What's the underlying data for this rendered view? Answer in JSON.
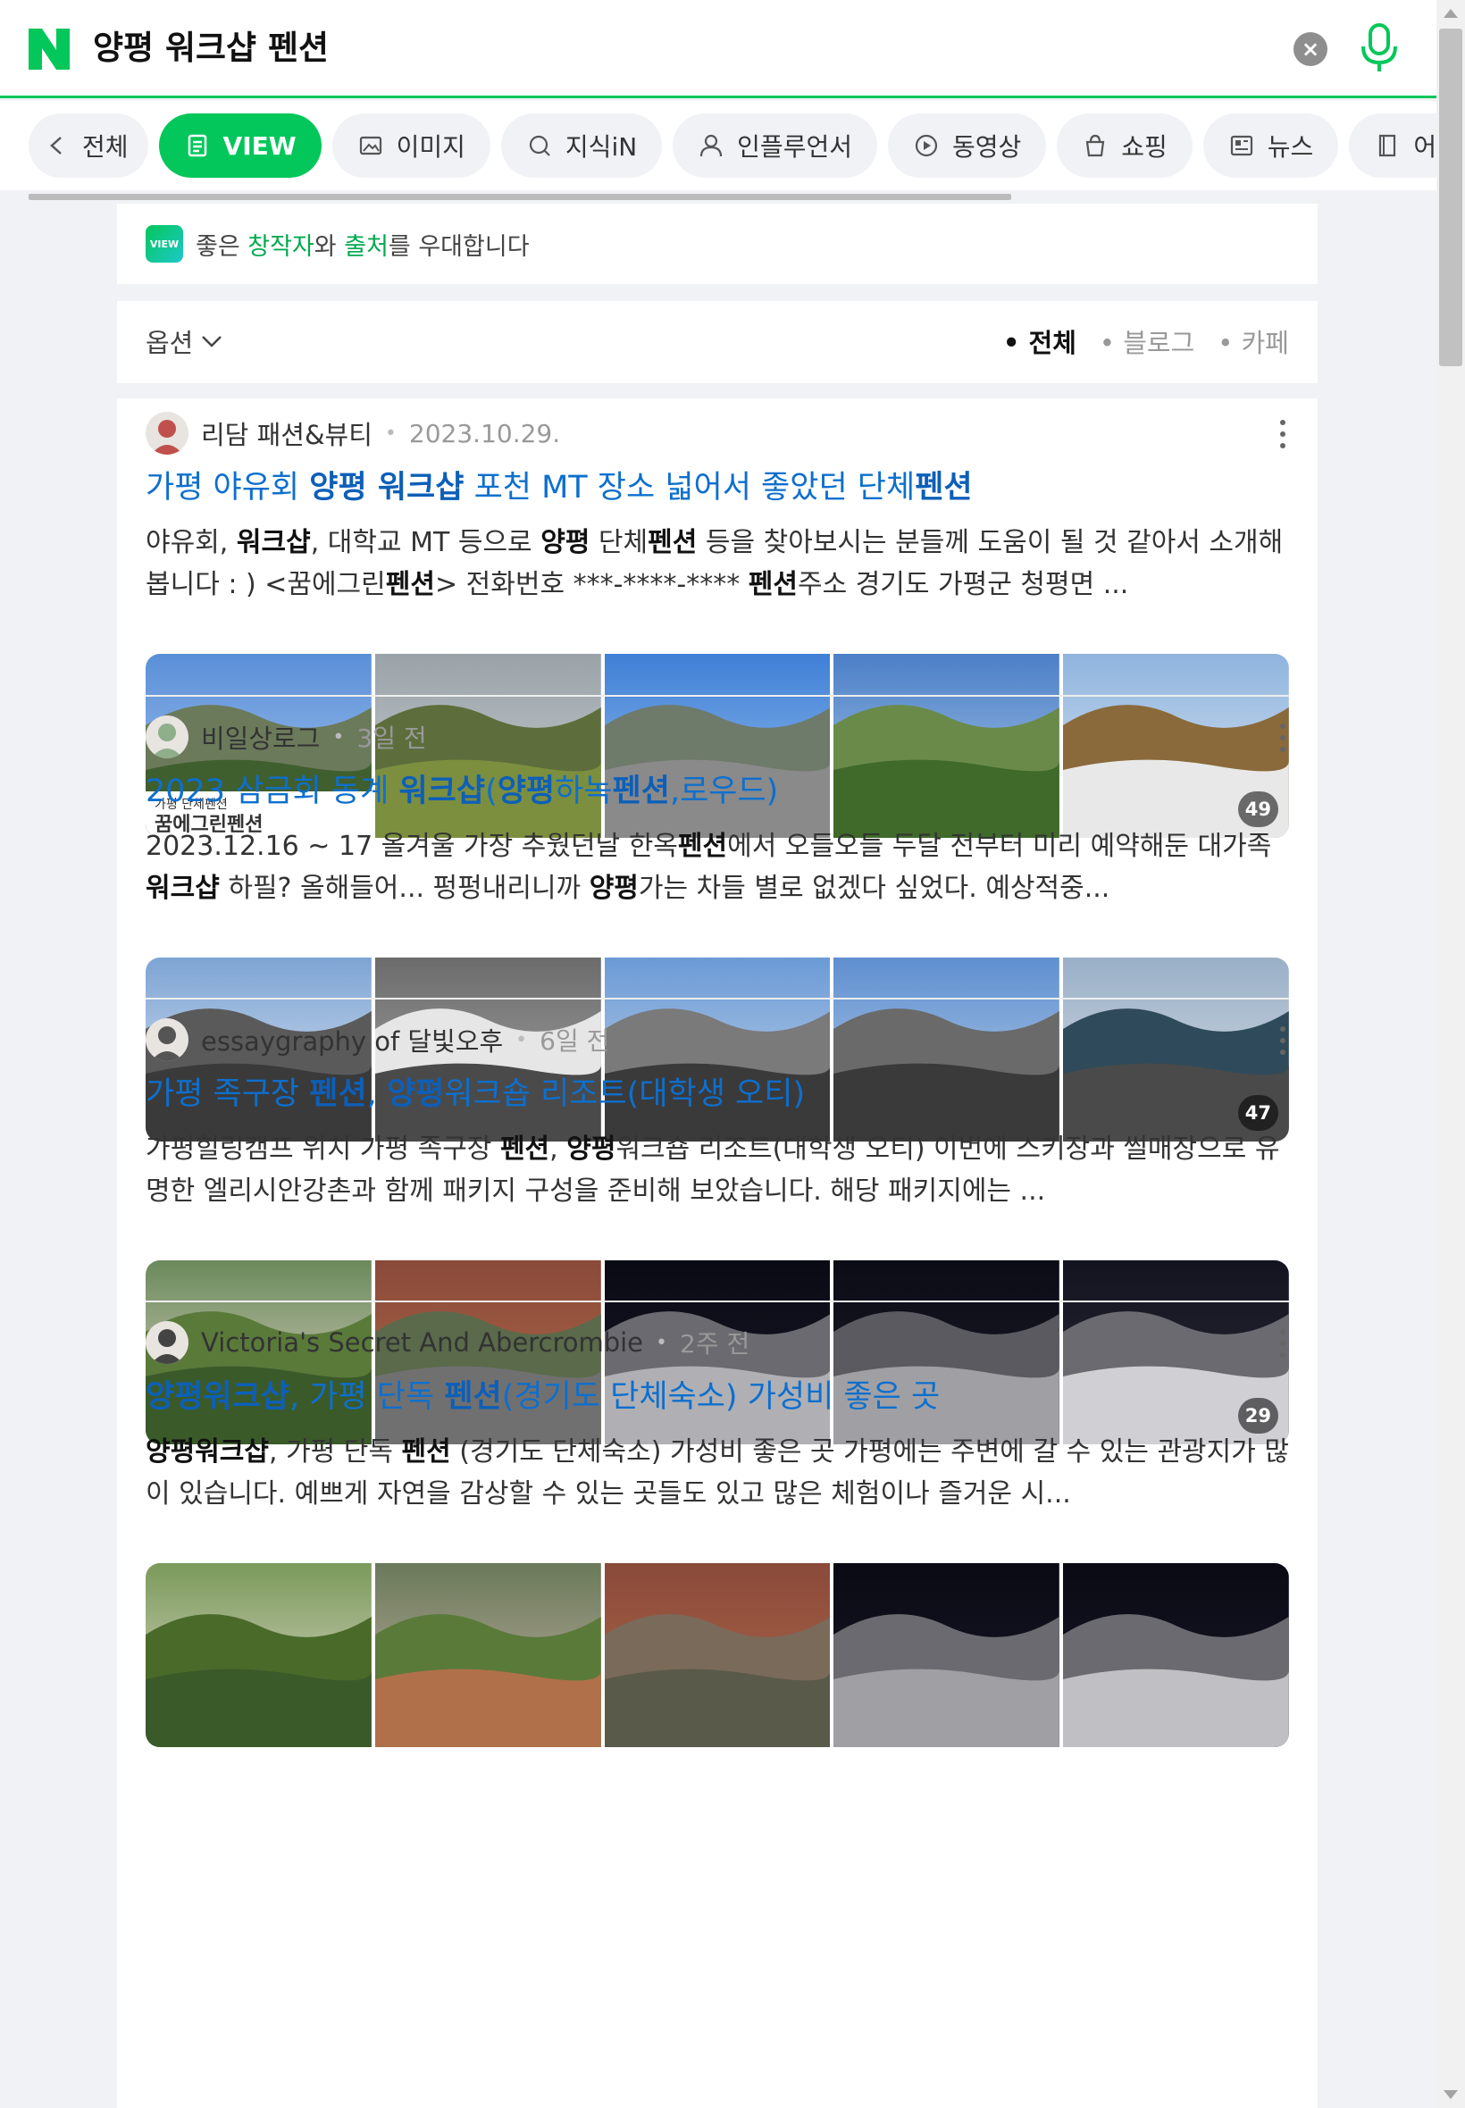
{
  "header": {
    "query": "양평 워크샵 펜션"
  },
  "tabs": [
    {
      "label": "전체",
      "icon": "chevron-left-icon"
    },
    {
      "label": "VIEW",
      "icon": "view-doc-icon",
      "active": true
    },
    {
      "label": "이미지",
      "icon": "image-icon"
    },
    {
      "label": "지식iN",
      "icon": "qna-icon"
    },
    {
      "label": "인플루언서",
      "icon": "person-icon"
    },
    {
      "label": "동영상",
      "icon": "play-icon"
    },
    {
      "label": "쇼핑",
      "icon": "bag-icon"
    },
    {
      "label": "뉴스",
      "icon": "news-icon"
    },
    {
      "label": "어학사전",
      "icon": "dictionary-icon"
    }
  ],
  "promo": {
    "badge": "VIEW",
    "p1": "좋은 ",
    "p2": "창작자",
    "p3": "와 ",
    "p4": "출처",
    "p5": "를 우대합니다"
  },
  "options": {
    "label": "옵션",
    "filters": [
      "전체",
      "블로그",
      "카페"
    ]
  },
  "results": [
    {
      "author": "리담 패션&뷰티",
      "date": "2023.10.29.",
      "title": [
        [
          "가평 야유회 ",
          false
        ],
        [
          "양평 워크샵",
          true
        ],
        [
          " 포천 MT 장소 넓어서 좋았던 단체",
          false
        ],
        [
          "펜션",
          true
        ]
      ],
      "desc": [
        [
          "야유회, ",
          false
        ],
        [
          "워크샵",
          true
        ],
        [
          ", 대학교 MT 등으로 ",
          false
        ],
        [
          "양평",
          true
        ],
        [
          " 단체",
          false
        ],
        [
          "펜션",
          true
        ],
        [
          " 등을 찾아보시는 분들께 도움이 될 것 같아서 소개해봅니다 : ) <꿈에그린",
          false
        ],
        [
          "펜션",
          true
        ],
        [
          "> 전화번호 ***-****-**** ",
          false
        ],
        [
          "펜션",
          true
        ],
        [
          "주소 경기도 가평군 청평면 ...",
          false
        ]
      ],
      "image_count": "49",
      "image_caption_small": "가평 단체펜션",
      "image_caption_large": "꿈에그린펜션"
    },
    {
      "author": "비일상로그",
      "date": "3일 전",
      "title": [
        [
          "2023 삼금회 동계 ",
          false
        ],
        [
          "워크샵",
          true
        ],
        [
          "(",
          false
        ],
        [
          "양평",
          true
        ],
        [
          "하녹",
          false
        ],
        [
          "펜션",
          true
        ],
        [
          ",로우드)",
          false
        ]
      ],
      "desc": [
        [
          "2023.12.16 ~ 17 올겨울 가장 추웠던날 한옥",
          false
        ],
        [
          "펜션",
          true
        ],
        [
          "에서 오들오들 두달 전부터 미리 예약해둔 대가족",
          false
        ],
        [
          "워크샵",
          true
        ],
        [
          " 하필? 올해들어... 펑펑내리니까 ",
          false
        ],
        [
          "양평",
          true
        ],
        [
          "가는 차들 별로 없겠다 싶었다. 예상적중...",
          false
        ]
      ],
      "image_count": "47"
    },
    {
      "author": "essaygraphy of 달빛오후",
      "date": "6일 전",
      "title": [
        [
          "가평 족구장 ",
          false
        ],
        [
          "펜션",
          true
        ],
        [
          ", ",
          false
        ],
        [
          "양평",
          true
        ],
        [
          "워크숍 리조트(대학생 오티)",
          false
        ]
      ],
      "desc": [
        [
          "가평힐링캠프 위치 가평 족구장 ",
          false
        ],
        [
          "펜션",
          true
        ],
        [
          ", ",
          false
        ],
        [
          "양평",
          true
        ],
        [
          "워크숍 리조트(대학생 오티) 이번에 스키장과 썰매장으로 유명한 엘리시안강촌과 함께 패키지 구성을 준비해 보았습니다. 해당 패키지에는 ...",
          false
        ]
      ],
      "image_count": "29"
    },
    {
      "author": "Victoria's Secret And Abercrombie",
      "date": "2주 전",
      "title": [
        [
          "양평워크샵",
          true
        ],
        [
          ", 가평 단독 ",
          false
        ],
        [
          "펜션",
          true
        ],
        [
          "(경기도 단체숙소) 가성비 좋은 곳",
          false
        ]
      ],
      "desc": [
        [
          "양평워크샵",
          true
        ],
        [
          ", 가평 단독 ",
          false
        ],
        [
          "펜션",
          true
        ],
        [
          " (경기도 단체숙소) 가성비 좋은 곳 가평에는 주변에 갈 수 있는 관광지가 많이 있습니다. 예쁘게 자연을 감상할 수 있는 곳들도 있고 많은 체험이나 즐거운 시...",
          false
        ]
      ],
      "image_count": ""
    }
  ],
  "colors": {
    "brand": "#03c75a",
    "link": "#0d6fce"
  }
}
